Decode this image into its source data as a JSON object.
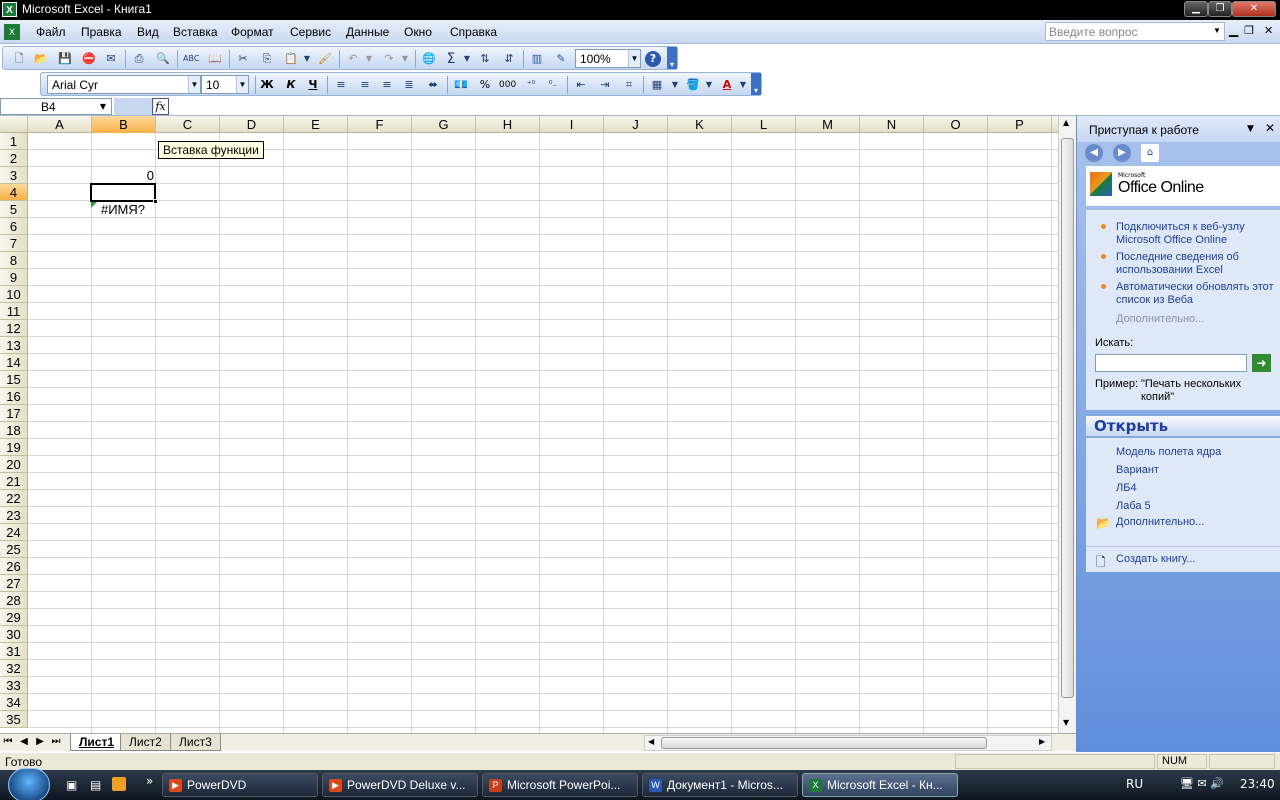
{
  "window": {
    "title": "Microsoft Excel - Книга1",
    "app_icon": "excel-icon"
  },
  "menu": {
    "items": [
      "Файл",
      "Правка",
      "Вид",
      "Вставка",
      "Формат",
      "Сервис",
      "Данные",
      "Окно",
      "Справка"
    ],
    "ask_placeholder": "Введите вопрос"
  },
  "toolbar": {
    "zoom": "100%",
    "font_name": "Arial Cyr",
    "font_size": "10",
    "bold": "Ж",
    "italic": "К",
    "underline": "Ч",
    "percent": "%",
    "thousands": "000"
  },
  "formula_bar": {
    "name_box": "B4",
    "fx_label": "fx",
    "tooltip": "Вставка функции"
  },
  "sheet": {
    "columns": [
      "A",
      "B",
      "C",
      "D",
      "E",
      "F",
      "G",
      "H",
      "I",
      "J",
      "K",
      "L",
      "M",
      "N",
      "O",
      "P"
    ],
    "rows": [
      "1",
      "2",
      "3",
      "4",
      "5",
      "6",
      "7",
      "8",
      "9",
      "10",
      "11",
      "12",
      "13",
      "14",
      "15",
      "16",
      "17",
      "18",
      "19",
      "20",
      "21",
      "22",
      "23",
      "24",
      "25",
      "26",
      "27",
      "28",
      "29",
      "30",
      "31",
      "32",
      "33",
      "34",
      "35"
    ],
    "selected_cell": "B4",
    "cells": {
      "B3": "0",
      "B5": "#ИМЯ?"
    }
  },
  "tabs": {
    "items": [
      "Лист1",
      "Лист2",
      "Лист3"
    ],
    "active": "Лист1"
  },
  "status": {
    "left": "Готово",
    "num": "NUM"
  },
  "task_pane": {
    "title": "Приступая к работе",
    "logo_small": "Microsoft",
    "logo": "Office Online",
    "links": [
      "Подключиться к веб-узлу Microsoft Office Online",
      "Последние сведения об использовании Excel",
      "Автоматически обновлять этот список из Веба"
    ],
    "more": "Дополнительно...",
    "search_label": "Искать:",
    "search_value": "",
    "example_label": "Пример:",
    "example_text": "\"Печать нескольких копий\"",
    "open_title": "Открыть",
    "recent_files": [
      "Модель полета ядра",
      "Вариант",
      "ЛБ4",
      "Лаба 5"
    ],
    "open_more": "Дополнительно...",
    "create": "Создать книгу..."
  },
  "taskbar": {
    "items": [
      "PowerDVD",
      "PowerDVD Deluxe v...",
      "Microsoft PowerPoi...",
      "Документ1 - Micros...",
      "Microsoft Excel - Кн..."
    ],
    "lang": "RU",
    "time": "23:40"
  }
}
